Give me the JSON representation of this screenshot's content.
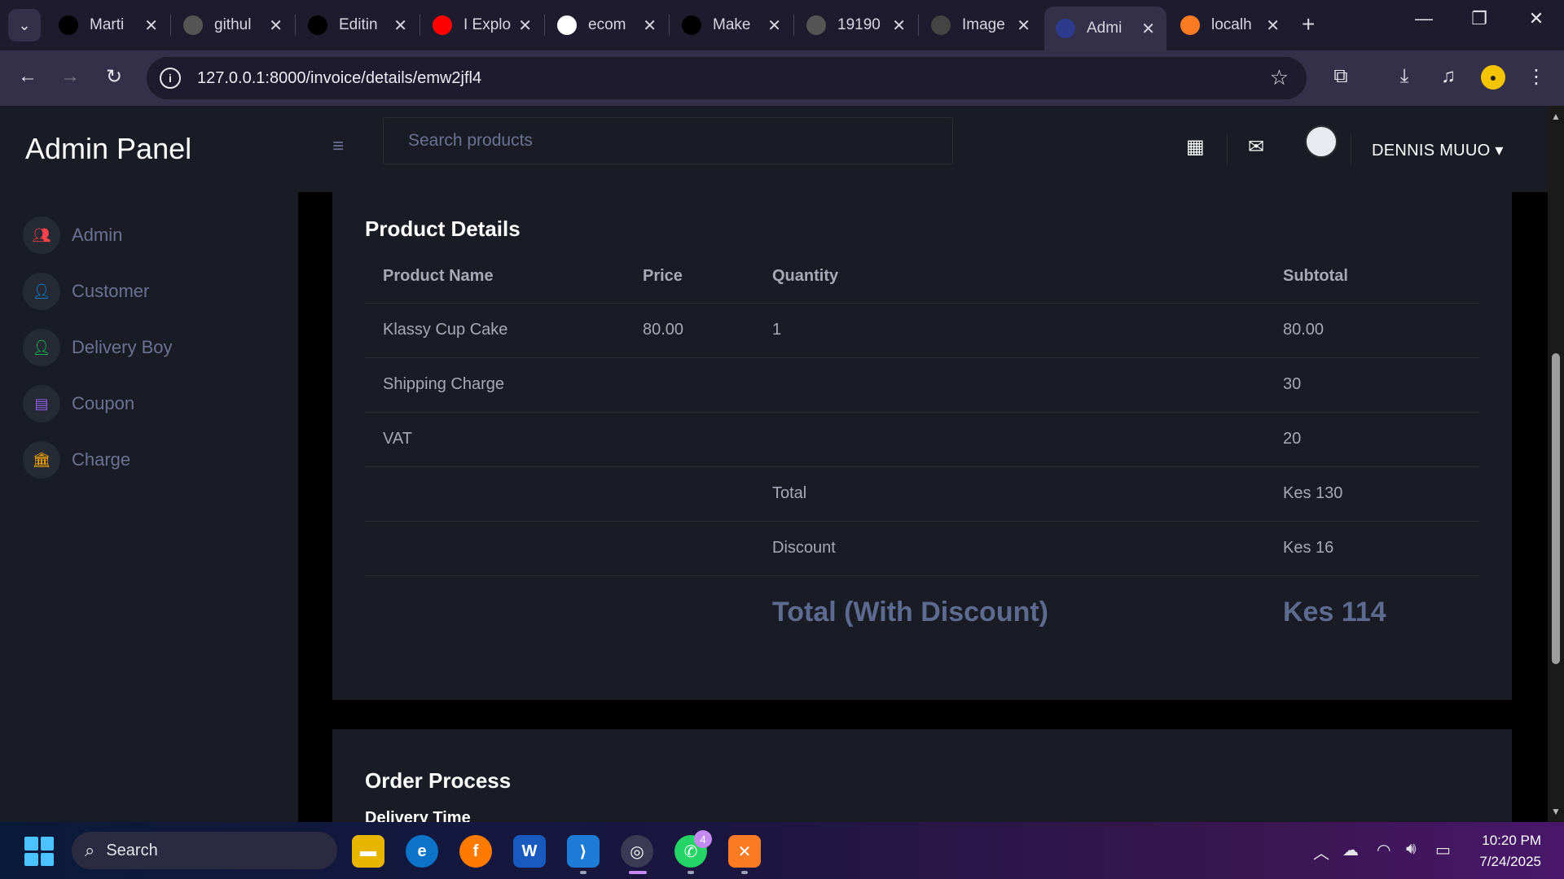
{
  "browser": {
    "tabs": [
      {
        "title": "Marti",
        "icon": "github-icon",
        "icon_color": "#000000"
      },
      {
        "title": "githul",
        "icon": "globe-icon",
        "icon_color": "#555555"
      },
      {
        "title": "Editin",
        "icon": "github-icon",
        "icon_color": "#000000"
      },
      {
        "title": "I Explo",
        "icon": "youtube-icon",
        "icon_color": "#ff0000"
      },
      {
        "title": "ecom",
        "icon": "google-icon",
        "icon_color": "#ffffff"
      },
      {
        "title": "Make",
        "icon": "medium-icon",
        "icon_color": "#000000"
      },
      {
        "title": "19190",
        "icon": "globe-icon",
        "icon_color": "#555555"
      },
      {
        "title": "Image",
        "icon": "openai-icon",
        "icon_color": "#444444"
      },
      {
        "title": "Admi",
        "icon": "admin-icon",
        "icon_color": "#2e3a8c",
        "active": true
      },
      {
        "title": "localh",
        "icon": "xampp-icon",
        "icon_color": "#fb7a24"
      }
    ],
    "url": "127.0.0.1:8000/invoice/details/emw2jfl4"
  },
  "app": {
    "brand": "Admin Panel",
    "search_placeholder": "Search products",
    "username": "DENNIS MUUO",
    "sidebar": [
      {
        "label": "Admin",
        "icon": "admin-group-icon",
        "color": "#fc424a"
      },
      {
        "label": "Customer",
        "icon": "user-add-icon",
        "color": "#0090e7"
      },
      {
        "label": "Delivery Boy",
        "icon": "user-add-icon",
        "color": "#00d25b"
      },
      {
        "label": "Coupon",
        "icon": "id-card-icon",
        "color": "#8f5fe8"
      },
      {
        "label": "Charge",
        "icon": "bank-icon",
        "color": "#ffab00"
      }
    ]
  },
  "product_details": {
    "title": "Product Details",
    "headers": [
      "Product Name",
      "Price",
      "Quantity",
      "Subtotal"
    ],
    "rows": [
      [
        "Klassy Cup Cake",
        "80.00",
        "1",
        "80.00"
      ],
      [
        "Shipping Charge",
        "",
        "",
        "30"
      ],
      [
        "VAT",
        "",
        "",
        "20"
      ],
      [
        "",
        "",
        "Total",
        "Kes 130"
      ],
      [
        "",
        "",
        "Discount",
        "Kes 16"
      ]
    ],
    "grand_total_label": "Total (With Discount)",
    "grand_total_value": "Kes 114"
  },
  "order_process": {
    "title": "Order Process",
    "subtitle": "Delivery Time"
  },
  "taskbar": {
    "search_label": "Search",
    "whatsapp_badge": "4",
    "time": "10:20 PM",
    "date": "7/24/2025"
  }
}
